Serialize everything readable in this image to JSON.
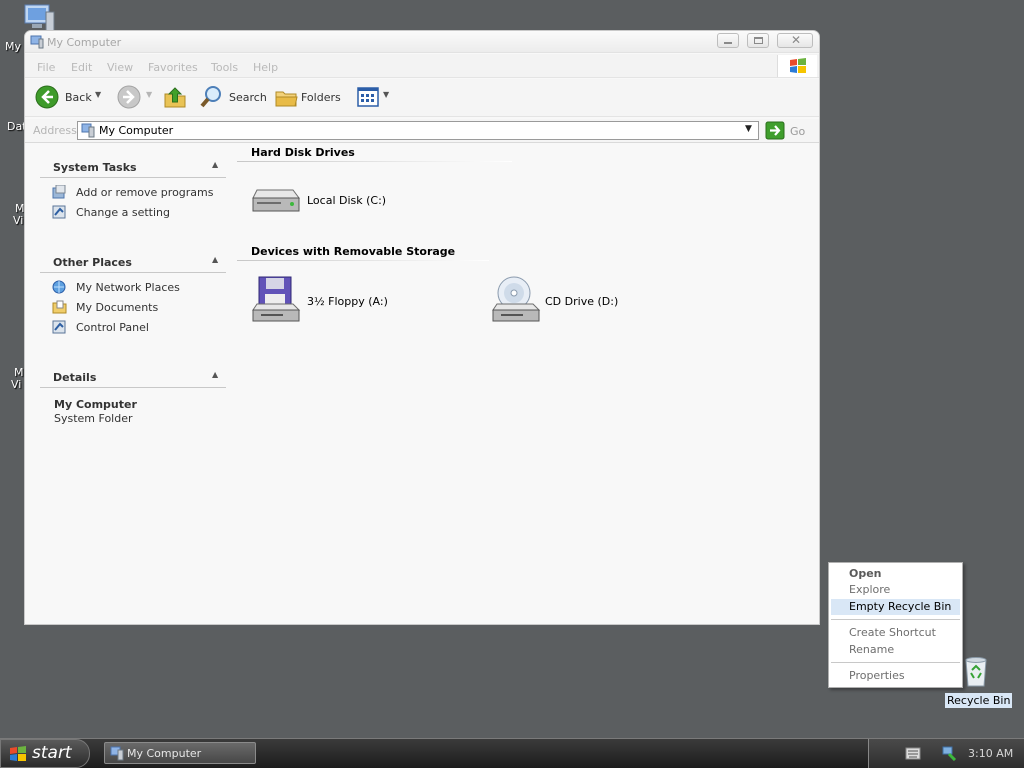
{
  "desktop": {
    "icons": [
      {
        "label": "My",
        "icon": "my-computer-icon"
      },
      {
        "label": "Dat",
        "icon": "folder-icon"
      },
      {
        "label": "M",
        "label2": "Vi",
        "icon": "shortcut-icon"
      },
      {
        "label": "M",
        "label2": "Vi",
        "icon": "shortcut-icon"
      }
    ],
    "recycle_bin": {
      "label": "Recycle Bin",
      "icon": "recycle-bin-icon"
    }
  },
  "window": {
    "title": "My Computer",
    "menu": [
      "File",
      "Edit",
      "View",
      "Favorites",
      "Tools",
      "Help"
    ],
    "toolbar": {
      "back_label": "Back",
      "search_label": "Search",
      "folders_label": "Folders"
    },
    "address": {
      "label": "Address",
      "value": "My Computer",
      "go_label": "Go"
    },
    "left_panel": {
      "system_tasks": {
        "title": "System Tasks",
        "items": [
          "Add or remove programs",
          "Change a setting"
        ]
      },
      "other_places": {
        "title": "Other Places",
        "items": [
          "My Network Places",
          "My Documents",
          "Control Panel"
        ]
      },
      "details": {
        "title": "Details",
        "name": "My Computer",
        "type": "System Folder"
      }
    },
    "content": {
      "groups": [
        {
          "title": "Hard Disk Drives",
          "items": [
            {
              "label": "Local Disk (C:)",
              "icon": "hard-disk-icon"
            }
          ]
        },
        {
          "title": "Devices with Removable Storage",
          "items": [
            {
              "label": "3½ Floppy (A:)",
              "icon": "floppy-drive-icon"
            },
            {
              "label": "CD Drive (D:)",
              "icon": "cd-drive-icon"
            }
          ]
        }
      ]
    }
  },
  "context_menu": {
    "items": [
      {
        "label": "Open",
        "bold": true
      },
      {
        "label": "Explore"
      },
      {
        "label": "Empty Recycle Bin",
        "highlighted": true
      },
      {
        "label": "Create Shortcut"
      },
      {
        "label": "Rename"
      },
      {
        "label": "Properties"
      }
    ]
  },
  "taskbar": {
    "start_label": "start",
    "tasks": [
      {
        "label": "My Computer"
      }
    ],
    "clock": "3:10 AM"
  },
  "colors": {
    "desktop": "#5b5e60",
    "highlight": "#d9e7f6",
    "highlight_text": "#000000"
  }
}
